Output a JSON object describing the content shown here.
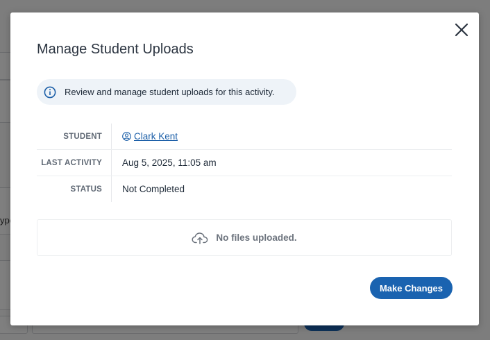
{
  "modal": {
    "title": "Manage Student Uploads",
    "info_text": "Review and manage student uploads for this activity.",
    "details": [
      {
        "label": "STUDENT",
        "value": "Clark Kent",
        "link": true
      },
      {
        "label": "LAST ACTIVITY",
        "value": "Aug 5, 2025, 11:05 am"
      },
      {
        "label": "STATUS",
        "value": "Not Completed"
      }
    ],
    "files_empty_text": "No files uploaded.",
    "primary_button": "Make Changes"
  },
  "background": {
    "fragment_text": "ype"
  },
  "colors": {
    "primary": "#1a63b0",
    "link": "#1c5fa8",
    "banner_bg": "#eef3f8",
    "title": "#2b3440"
  },
  "icons": {
    "close": "close-icon",
    "info": "info-icon",
    "student": "user-icon",
    "files": "cloud-upload-icon"
  }
}
